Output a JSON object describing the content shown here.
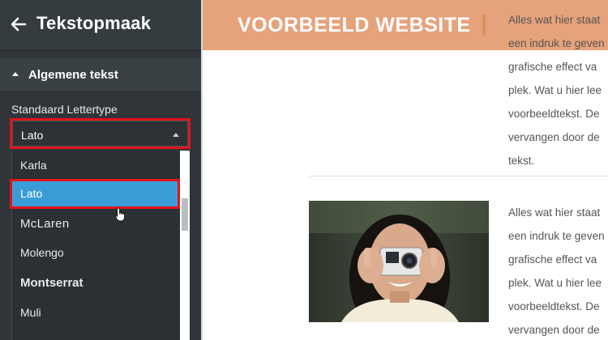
{
  "sidebar": {
    "back_icon": "arrow-left-icon",
    "title": "Tekstopmaak",
    "section_label": "Algemene tekst",
    "field_label": "Standaard Lettertype",
    "selected_value": "Lato",
    "dropdown_options": [
      "Karla",
      "Lato",
      "McLaren",
      "Molengo",
      "Montserrat",
      "Muli"
    ],
    "highlight_color": "#3b9dd8",
    "annotation_color": "#e3131b"
  },
  "preview": {
    "banner_title": "VOORBEELD WEBSITE",
    "banner_color": "#e6a27b",
    "top_text_lines": [
      "Alles wat hier staat",
      "een indruk te geven",
      "grafische effect va",
      "plek. Wat u hier lee",
      "voorbeeldtekst. De",
      "vervangen door de",
      "tekst."
    ],
    "bottom_text_lines": [
      "Alles wat hier staat",
      "een indruk te geven",
      "grafische effect va",
      "plek. Wat u hier lee",
      "voorbeeldtekst. De",
      "vervangen door de"
    ]
  }
}
